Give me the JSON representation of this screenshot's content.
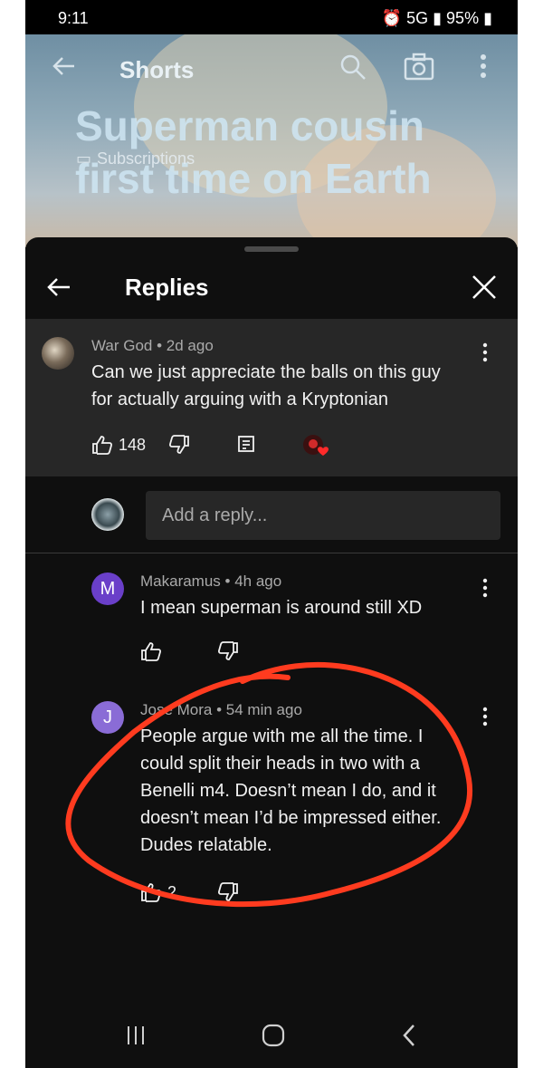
{
  "status_bar": {
    "time": "9:11",
    "network": "5G",
    "battery": "95%"
  },
  "header": {
    "title": "Shorts"
  },
  "video": {
    "title": "Superman cousin first time on Earth",
    "subscriptions_label": "Subscriptions"
  },
  "sheet": {
    "title": "Replies"
  },
  "parent_comment": {
    "author": "War God",
    "time": "2d ago",
    "text_line1": "Can we just appreciate the balls on this guy",
    "text_line2": "for actually arguing with a Kryptonian",
    "likes": "148"
  },
  "reply_input": {
    "placeholder": "Add a reply..."
  },
  "replies": [
    {
      "avatar_letter": "M",
      "author": "Makaramus",
      "time": "4h ago",
      "avatar_color": "#6a3fc9",
      "lines": [
        "I mean superman is around still XD"
      ],
      "likes": ""
    },
    {
      "avatar_letter": "J",
      "author": "Jose Mora",
      "time": "54 min ago",
      "avatar_color": "#8a6cd6",
      "lines": [
        "People argue with me all the time. I",
        "could split their heads in two with a",
        "Benelli m4. Doesn’t mean I do, and it",
        "doesn’t mean I’d be impressed either.",
        "Dudes relatable."
      ],
      "likes": "2"
    }
  ],
  "colors": {
    "annotation": "#ff3b1f",
    "sheet_bg": "#0f0f0f",
    "parent_bg": "#272727"
  }
}
